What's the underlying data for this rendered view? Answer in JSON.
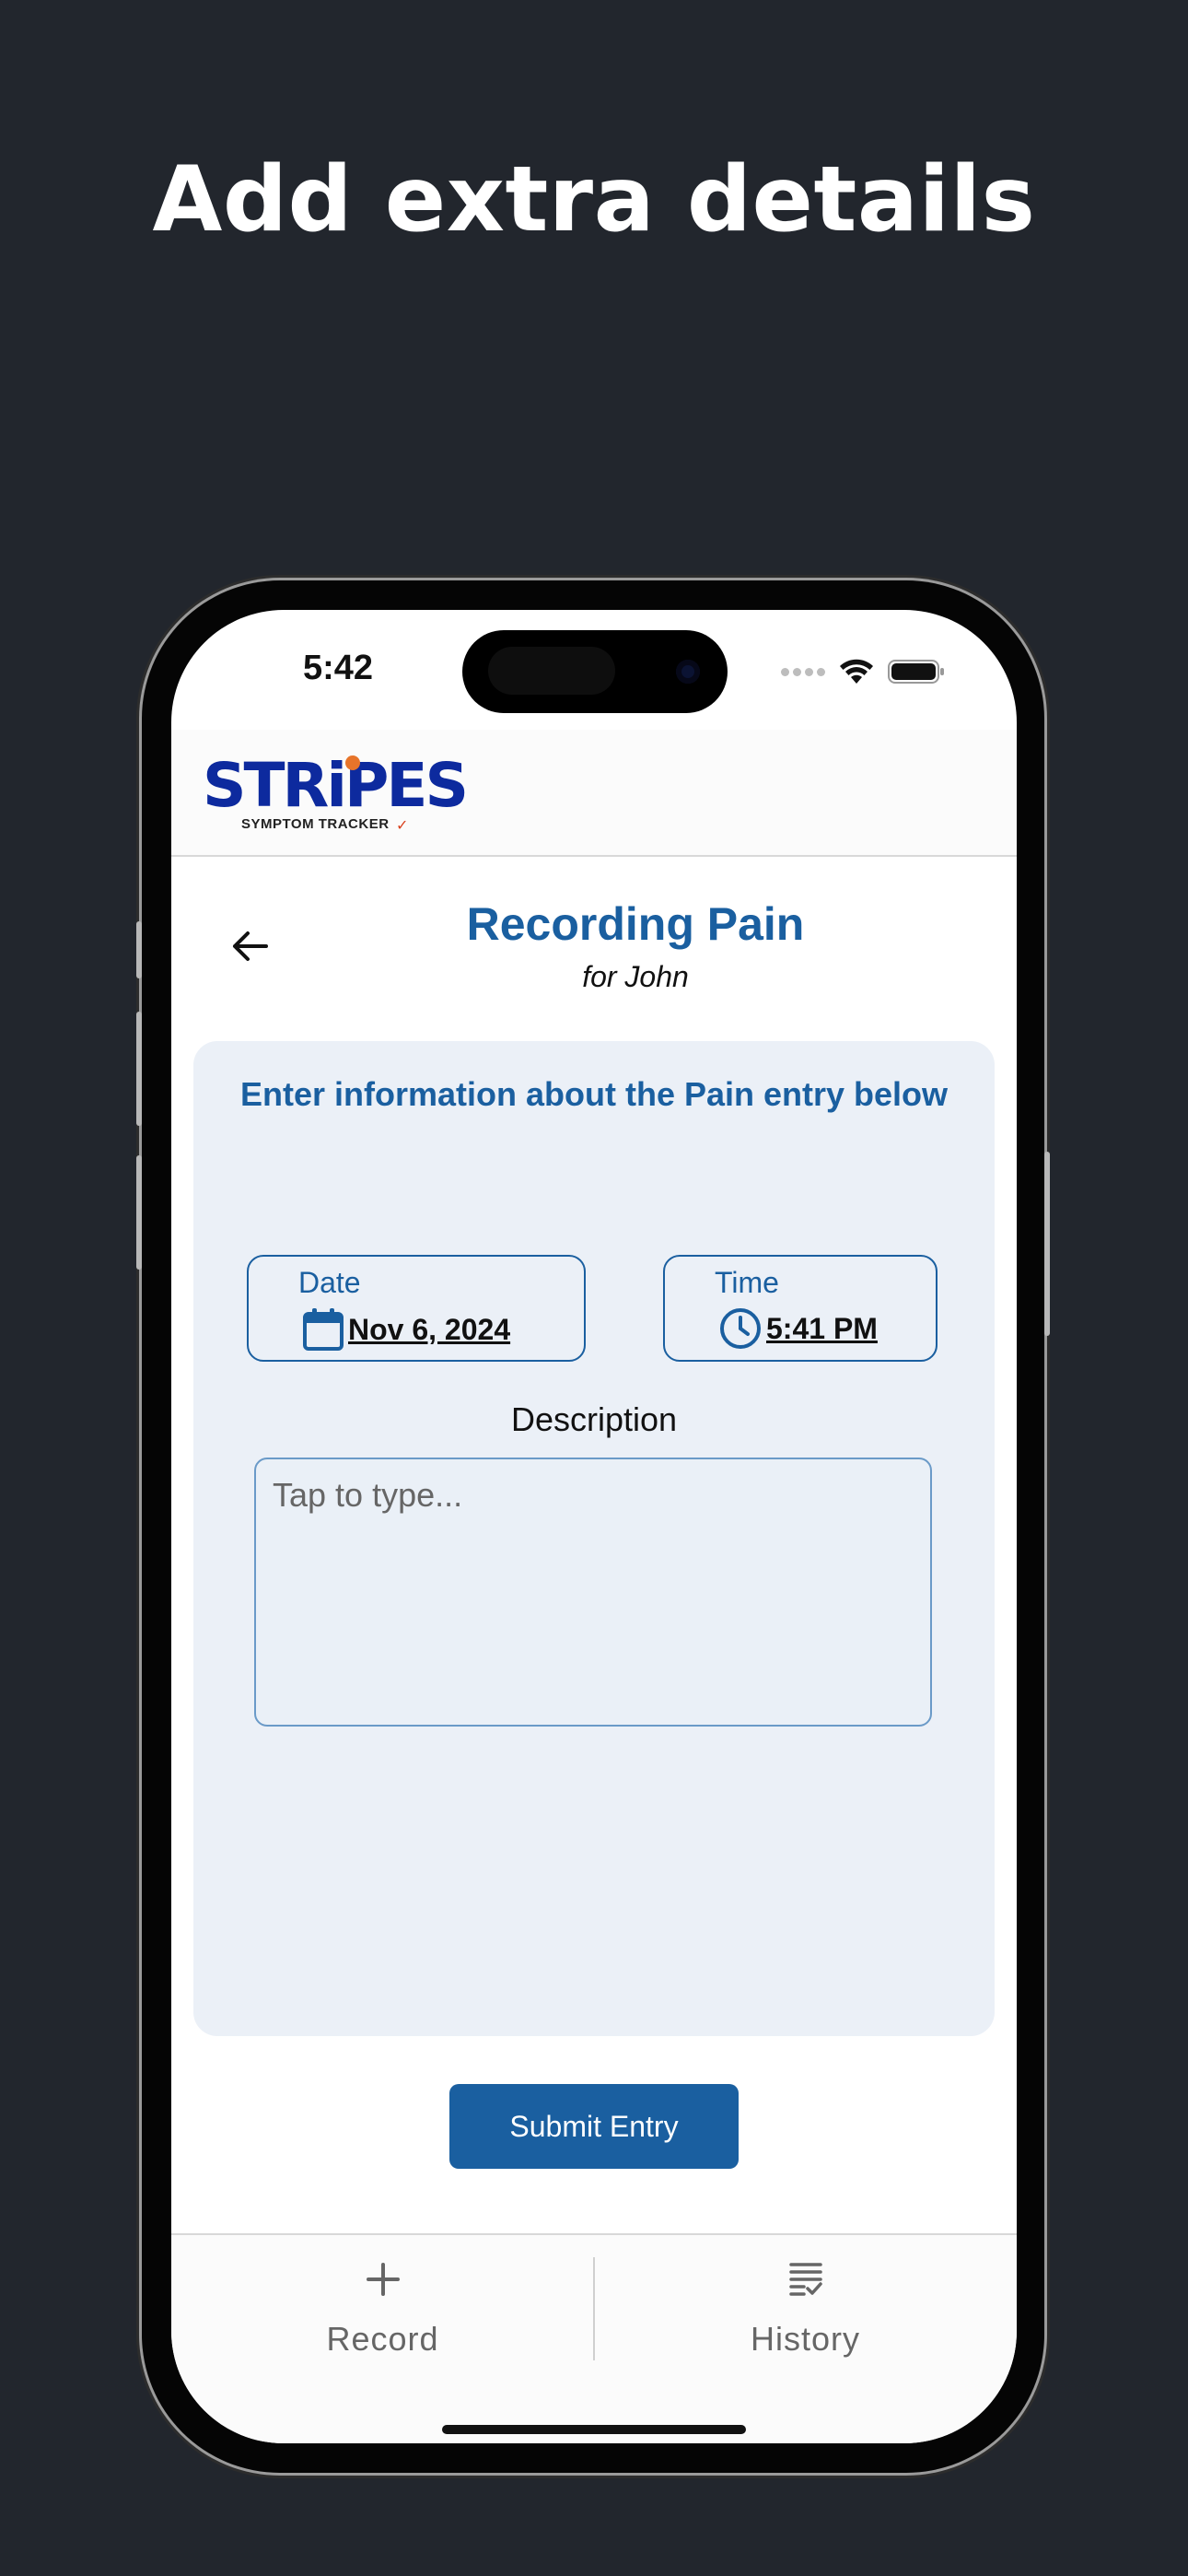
{
  "headline": "Add extra details",
  "status_bar": {
    "time": "5:42"
  },
  "app": {
    "logo_word": "STRiPES",
    "logo_subtitle": "SYMPTOM TRACKER"
  },
  "page": {
    "title": "Recording Pain",
    "subtitle": "for John"
  },
  "form": {
    "instruction": "Enter information about the Pain entry below",
    "date_label": "Date",
    "date_value": "Nov 6, 2024",
    "time_label": "Time",
    "time_value": "5:41 PM",
    "description_label": "Description",
    "description_value": "",
    "description_placeholder": "Tap to type...",
    "submit_label": "Submit Entry"
  },
  "bottom_nav": {
    "items": [
      {
        "label": "Record",
        "icon": "plus-icon"
      },
      {
        "label": "History",
        "icon": "list-check-icon"
      }
    ]
  },
  "colors": {
    "background": "#22262d",
    "accent": "#1a5fa0",
    "logo_blue": "#0d2a9e",
    "card_background": "#ebf0f7"
  }
}
